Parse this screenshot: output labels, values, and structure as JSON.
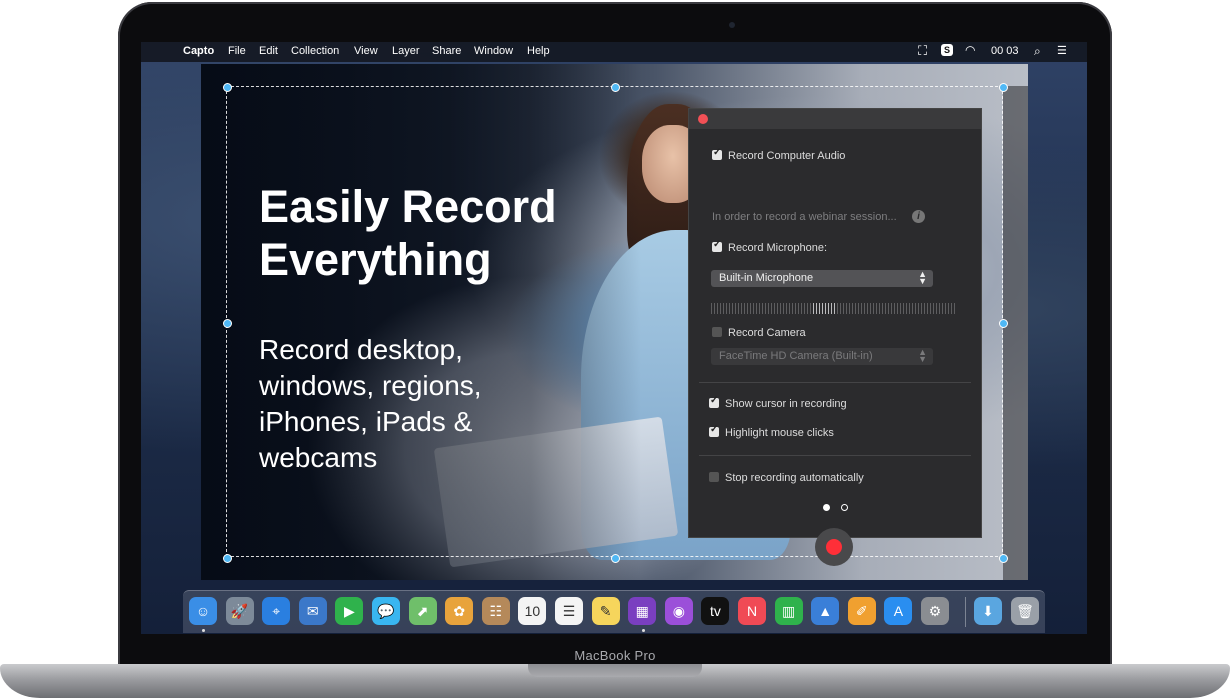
{
  "device": {
    "brand": "MacBook Pro"
  },
  "menubar": {
    "app_name": "Capto",
    "menus": [
      "File",
      "Edit",
      "Collection",
      "View",
      "Layer",
      "Share",
      "Window",
      "Help"
    ],
    "clock": "00 03",
    "status_icons": [
      "selection-capture-icon",
      "capto-status-icon",
      "wifi-icon",
      "search-icon",
      "list-icon"
    ]
  },
  "promo": {
    "headline_line1": "Easily Record",
    "headline_line2": "Everything",
    "sub_lines": [
      "Record desktop,",
      "windows, regions,",
      "iPhones, iPads &",
      "webcams"
    ]
  },
  "panel": {
    "computer_audio": {
      "label": "Record Computer Audio",
      "checked": true
    },
    "audio_hint": "In order to record a webinar session...",
    "microphone": {
      "label": "Record Microphone:",
      "checked": true
    },
    "microphone_device": "Built-in Microphone",
    "camera": {
      "label": "Record Camera",
      "checked": false
    },
    "camera_device": "FaceTime HD Camera (Built-in)",
    "show_cursor": {
      "label": "Show cursor in recording",
      "checked": true
    },
    "highlight_clicks": {
      "label": "Highlight mouse clicks",
      "checked": true
    },
    "stop_auto": {
      "label": "Stop recording automatically",
      "checked": false
    },
    "page_indicator": {
      "current": 1,
      "total": 2
    }
  },
  "colors": {
    "record_red": "#ff2f38",
    "selection_handle": "#4fb8f5",
    "close_red": "#f25056"
  },
  "dock": {
    "apps": [
      {
        "name": "finder-icon",
        "glyph": "☺",
        "color": "#3a8ee6"
      },
      {
        "name": "launchpad-icon",
        "glyph": "🚀",
        "color": "#7d8a99"
      },
      {
        "name": "safari-icon",
        "glyph": "⌖",
        "color": "#2a7fe0"
      },
      {
        "name": "mail-icon",
        "glyph": "✉",
        "color": "#3b78c9"
      },
      {
        "name": "facetime-icon",
        "glyph": "▶",
        "color": "#2fb24c"
      },
      {
        "name": "messages-icon",
        "glyph": "💬",
        "color": "#39b6f0"
      },
      {
        "name": "maps-icon",
        "glyph": "⬈",
        "color": "#6fbf6a"
      },
      {
        "name": "photos-icon",
        "glyph": "✿",
        "color": "#e8a33c"
      },
      {
        "name": "contacts-icon",
        "glyph": "☷",
        "color": "#b5895a"
      },
      {
        "name": "calendar-icon",
        "glyph": "10",
        "color": "#f4f4f4"
      },
      {
        "name": "reminders-icon",
        "glyph": "☰",
        "color": "#f4f4f4"
      },
      {
        "name": "notes-icon",
        "glyph": "✎",
        "color": "#f6d55c"
      },
      {
        "name": "capto-icon",
        "glyph": "▦",
        "color": "#7a3fc0"
      },
      {
        "name": "podcasts-icon",
        "glyph": "◉",
        "color": "#9b4fd9"
      },
      {
        "name": "apple-tv-icon",
        "glyph": "tv",
        "color": "#111"
      },
      {
        "name": "news-icon",
        "glyph": "N",
        "color": "#f04a55"
      },
      {
        "name": "numbers-icon",
        "glyph": "▥",
        "color": "#2fb24c"
      },
      {
        "name": "keynote-icon",
        "glyph": "▲",
        "color": "#3a7fd8"
      },
      {
        "name": "pages-icon",
        "glyph": "✐",
        "color": "#f0a030"
      },
      {
        "name": "app-store-icon",
        "glyph": "A",
        "color": "#2a8ef0"
      },
      {
        "name": "system-preferences-icon",
        "glyph": "⚙",
        "color": "#8a8d92"
      }
    ],
    "extras": [
      {
        "name": "downloads-folder-icon",
        "glyph": "⬇",
        "color": "#5aa6e0"
      },
      {
        "name": "trash-icon",
        "glyph": "🗑",
        "color": "#9aa0a8"
      }
    ]
  }
}
